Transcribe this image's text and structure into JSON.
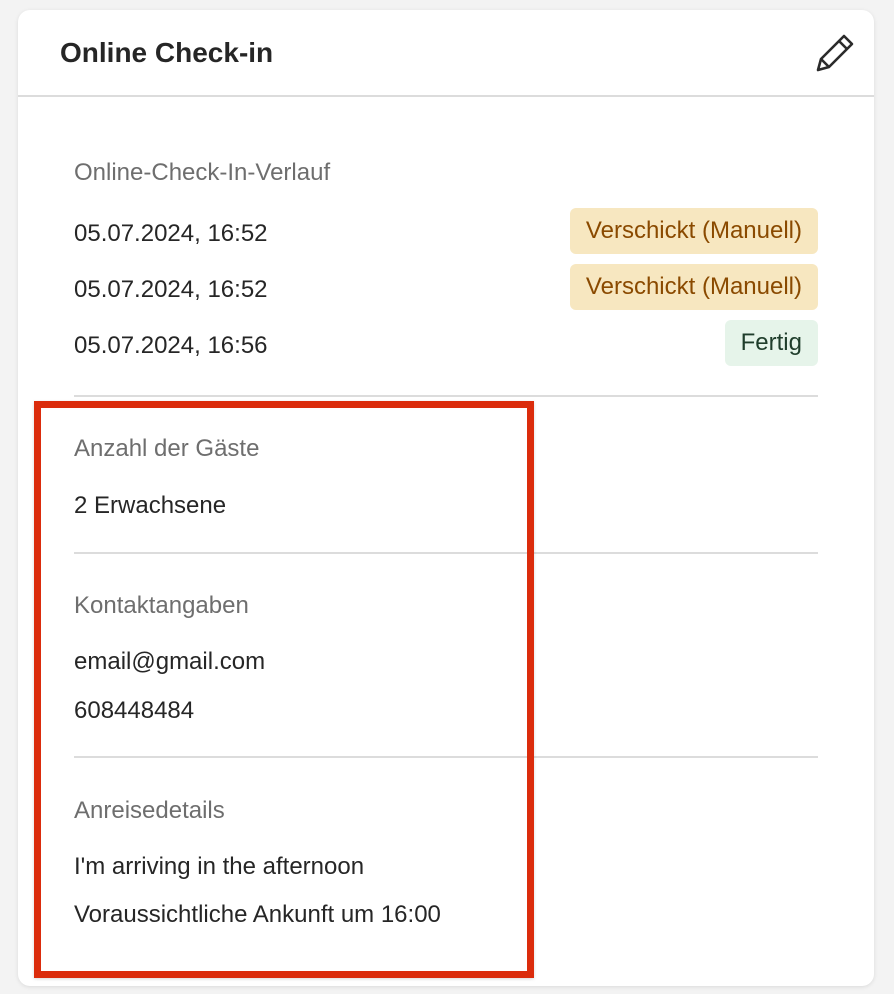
{
  "card": {
    "title": "Online Check-in",
    "edit_icon": "pencil-icon"
  },
  "history": {
    "label": "Online-Check-In-Verlauf",
    "entries": [
      {
        "timestamp": "05.07.2024, 16:52",
        "status": "Verschickt (Manuell)",
        "status_bg": "#f7e7c0",
        "status_color": "#8a4a00"
      },
      {
        "timestamp": "05.07.2024, 16:52",
        "status": "Verschickt (Manuell)",
        "status_bg": "#f7e7c0",
        "status_color": "#8a4a00"
      },
      {
        "timestamp": "05.07.2024, 16:56",
        "status": "Fertig",
        "status_bg": "#e6f4ea",
        "status_color": "#1f3d2b"
      }
    ]
  },
  "guests": {
    "label": "Anzahl der Gäste",
    "value": "2 Erwachsene"
  },
  "contact": {
    "label": "Kontaktangaben",
    "email": "email@gmail.com",
    "phone": "608448484"
  },
  "arrival": {
    "label": "Anreisedetails",
    "note": "I'm arriving in the afternoon",
    "eta": "Voraussichtliche Ankunft um 16:00"
  },
  "colors": {
    "highlight": "#db2c0c",
    "divider": "#dcdcdc"
  }
}
